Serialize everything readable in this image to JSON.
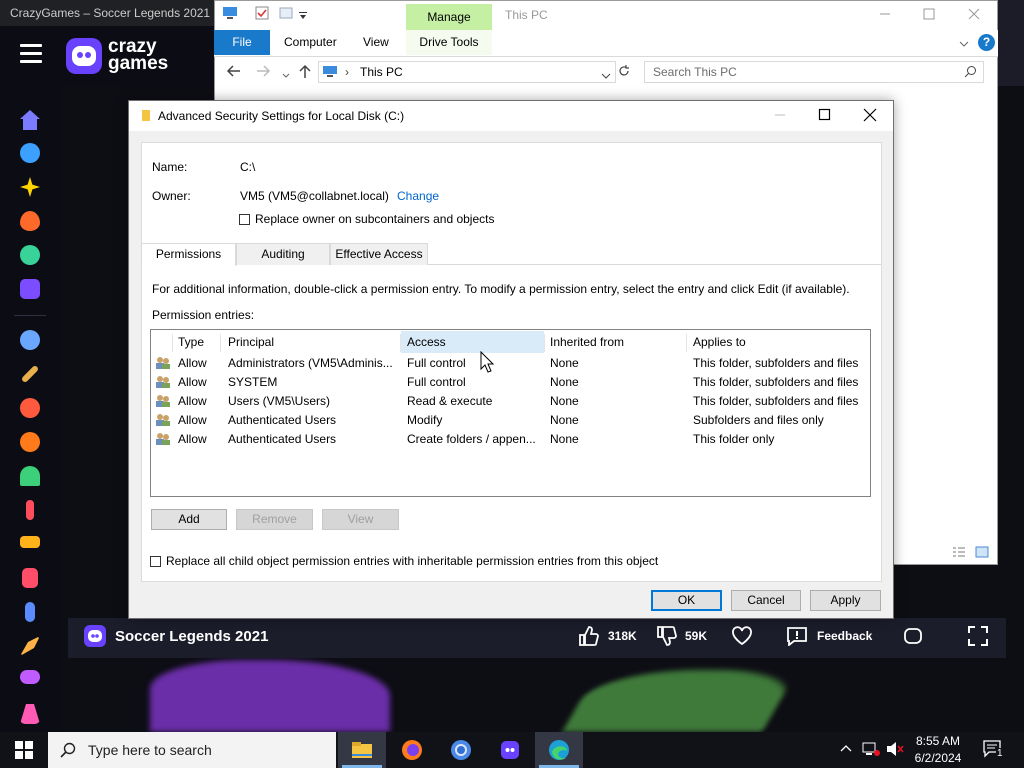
{
  "browser": {
    "tab_title": "CrazyGames – Soccer Legends 2021"
  },
  "crazygames": {
    "logo_line1": "crazy",
    "logo_line2": "games",
    "sidebar_icons": [
      "home-icon",
      "recent-icon",
      "new-icon",
      "trending-icon",
      "updated-icon",
      "originals-icon",
      "multiplayer-icon",
      "action-icon",
      "adventure-icon",
      "basketball-icon",
      "beauty-icon",
      "bike-icon",
      "car-icon",
      "card-icon",
      "clicker-icon",
      "io-icon",
      "casual-icon",
      "dress-up-icon"
    ],
    "game_title": "Soccer Legends 2021",
    "likes": "318K",
    "dislikes": "59K",
    "feedback_label": "Feedback"
  },
  "explorer": {
    "manage_tab": "Manage",
    "window_title": "This PC",
    "tabs": [
      "File",
      "Computer",
      "View",
      "Drive Tools"
    ],
    "address": "This PC",
    "search_placeholder": "Search This PC"
  },
  "dialog": {
    "title": "Advanced Security Settings for Local Disk (C:)",
    "name_label": "Name:",
    "name_value": "C:\\",
    "owner_label": "Owner:",
    "owner_value": "VM5 (VM5@collabnet.local)",
    "change_link": "Change",
    "replace_owner_label": "Replace owner on subcontainers and objects",
    "tabs": [
      "Permissions",
      "Auditing",
      "Effective Access"
    ],
    "info_text": "For additional information, double-click a permission entry. To modify a permission entry, select the entry and click Edit (if available).",
    "entries_label": "Permission entries:",
    "columns": [
      "Type",
      "Principal",
      "Access",
      "Inherited from",
      "Applies to"
    ],
    "rows": [
      {
        "type": "Allow",
        "principal": "Administrators (VM5\\Adminis...",
        "access": "Full control",
        "inherited": "None",
        "applies": "This folder, subfolders and files"
      },
      {
        "type": "Allow",
        "principal": "SYSTEM",
        "access": "Full control",
        "inherited": "None",
        "applies": "This folder, subfolders and files"
      },
      {
        "type": "Allow",
        "principal": "Users (VM5\\Users)",
        "access": "Read & execute",
        "inherited": "None",
        "applies": "This folder, subfolders and files"
      },
      {
        "type": "Allow",
        "principal": "Authenticated Users",
        "access": "Modify",
        "inherited": "None",
        "applies": "Subfolders and files only"
      },
      {
        "type": "Allow",
        "principal": "Authenticated Users",
        "access": "Create folders / appen...",
        "inherited": "None",
        "applies": "This folder only"
      }
    ],
    "add_button": "Add",
    "remove_button": "Remove",
    "view_button": "View",
    "replace_child_label": "Replace all child object permission entries with inheritable permission entries from this object",
    "ok_button": "OK",
    "cancel_button": "Cancel",
    "apply_button": "Apply"
  },
  "taskbar": {
    "search_placeholder": "Type here to search",
    "time": "8:55 AM",
    "date": "6/2/2024",
    "notification_count": "1"
  }
}
